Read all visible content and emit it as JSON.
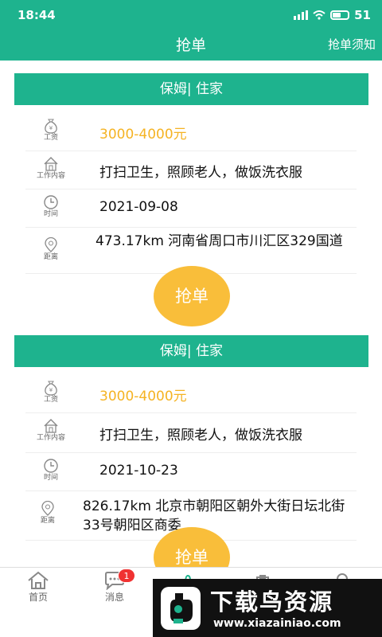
{
  "status_bar": {
    "time": "18:44",
    "battery": "51"
  },
  "header": {
    "title": "抢单",
    "notice_link": "抢单须知"
  },
  "labels": {
    "salary": "工资",
    "work_content": "工作内容",
    "time": "时间",
    "distance": "距离"
  },
  "orders": [
    {
      "category": "保姆| 住家",
      "salary": "3000-4000元",
      "work_content": "打扫卫生，照顾老人，做饭洗衣服",
      "date": "2021-09-08",
      "distance_address": "473.17km 河南省周口市川汇区329国道",
      "grab_label": "抢单"
    },
    {
      "category": "保姆| 住家",
      "salary": "3000-4000元",
      "work_content": "打扫卫生，照顾老人，做饭洗衣服",
      "date": "2021-10-23",
      "distance_address": "826.17km 北京市朝阳区朝外大街日坛北街33号朝阳区商委",
      "grab_label": "抢单"
    }
  ],
  "tabbar": {
    "home": "首页",
    "messages": "消息",
    "messages_badge": "1"
  },
  "watermark": {
    "title": "下载鸟资源",
    "url": "www.xiazainiao.com"
  },
  "colors": {
    "primary": "#1eb38e",
    "accent": "#f9be3a",
    "salary": "#f5b323",
    "badge": "#f03232"
  }
}
